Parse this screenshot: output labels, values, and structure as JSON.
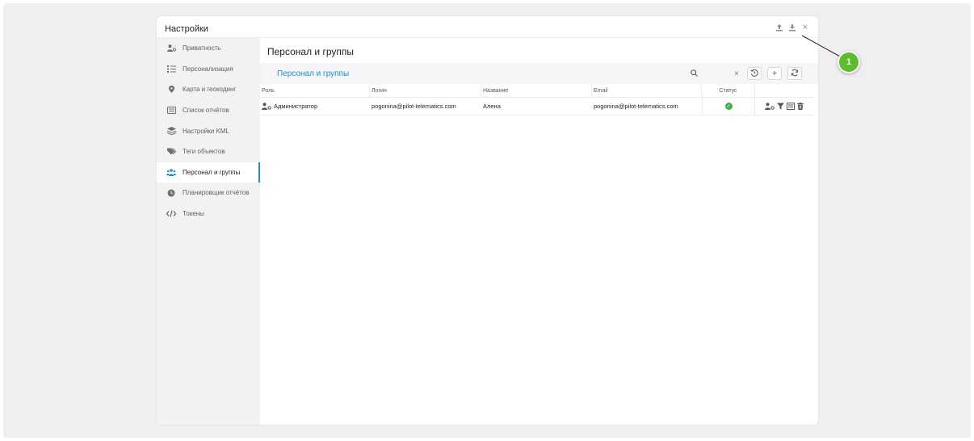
{
  "dialog": {
    "title": "Настройки",
    "window_actions": [
      "upload-icon",
      "download-icon",
      "close-icon"
    ]
  },
  "sidebar": {
    "items": [
      {
        "label": "Приватность",
        "icon": "user-key-icon"
      },
      {
        "label": "Персонализация",
        "icon": "list-ordered-icon"
      },
      {
        "label": "Карта и геокодинг",
        "icon": "map-marker-icon"
      },
      {
        "label": "Список отчётов",
        "icon": "report-list-icon"
      },
      {
        "label": "Настройки KML",
        "icon": "layers-icon"
      },
      {
        "label": "Теги объектов",
        "icon": "tags-icon"
      },
      {
        "label": "Персонал и группы",
        "icon": "users-icon",
        "active": true
      },
      {
        "label": "Планировщик отчётов",
        "icon": "clock-icon"
      },
      {
        "label": "Токены",
        "icon": "code-icon"
      }
    ]
  },
  "main": {
    "title": "Персонал и группы",
    "toolbar": {
      "title": "Персонал и группы",
      "search_placeholder": "",
      "buttons": [
        "history-icon",
        "add-icon",
        "refresh-icon"
      ]
    },
    "table": {
      "columns": [
        "Роль",
        "Логин",
        "Название",
        "Email",
        "Статус",
        ""
      ],
      "rows": [
        {
          "role": "Администратор",
          "login": "pogonina@pilot-telematics.com",
          "name": "Алена",
          "email": "pogonina@pilot-telematics.com",
          "status": "active",
          "actions": [
            "user-key-icon",
            "filter-icon",
            "list-icon",
            "trash-icon"
          ]
        }
      ]
    }
  },
  "annotation": {
    "number": "1"
  },
  "colors": {
    "accent": "#1a8fd6",
    "status_ok": "#3cb34a",
    "annotation": "#5bbd2b"
  }
}
